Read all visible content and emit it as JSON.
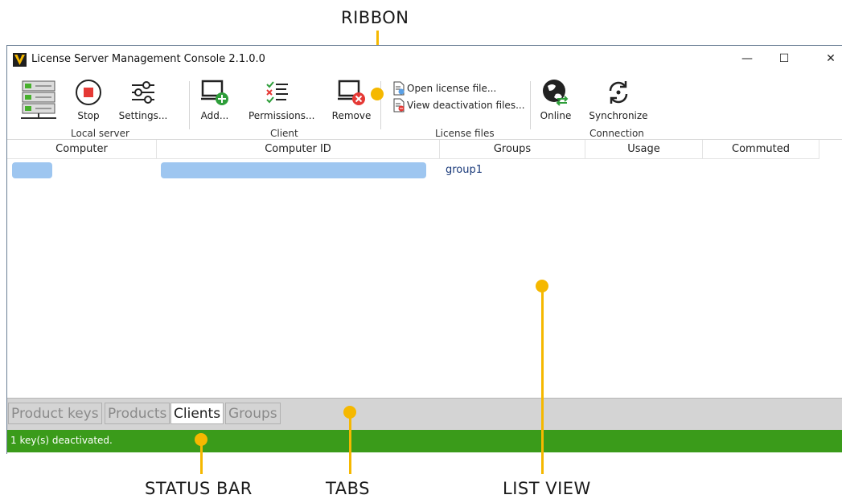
{
  "callouts": {
    "ribbon": "RIBBON",
    "status_bar": "STATUS BAR",
    "tabs": "TABS",
    "list_view": "LIST VIEW"
  },
  "window": {
    "title": "License Server Management Console 2.1.0.0",
    "controls": {
      "minimize": "—",
      "maximize": "☐",
      "close": "✕"
    }
  },
  "ribbon": {
    "local_server": {
      "label": "Local server",
      "stop": "Stop",
      "settings": "Settings..."
    },
    "client": {
      "label": "Client",
      "add": "Add...",
      "permissions": "Permissions...",
      "remove": "Remove"
    },
    "license_files": {
      "label": "License files",
      "open": "Open license file...",
      "view": "View deactivation files..."
    },
    "connection": {
      "label": "Connection",
      "online": "Online",
      "synchronize": "Synchronize"
    }
  },
  "list": {
    "columns": [
      "Computer",
      "Computer ID",
      "Groups",
      "Usage",
      "Commuted"
    ],
    "rows": [
      {
        "computer": "",
        "computer_id": "",
        "groups": "group1",
        "usage": "",
        "commuted": ""
      }
    ]
  },
  "tabs": [
    {
      "label": "Product keys",
      "active": false
    },
    {
      "label": "Products",
      "active": false
    },
    {
      "label": "Clients",
      "active": true
    },
    {
      "label": "Groups",
      "active": false
    }
  ],
  "status": {
    "text": "1 key(s) deactivated."
  },
  "colors": {
    "accent": "#f5b800",
    "status_bg": "#3a9b1a",
    "redacted": "#9ec6f0"
  }
}
